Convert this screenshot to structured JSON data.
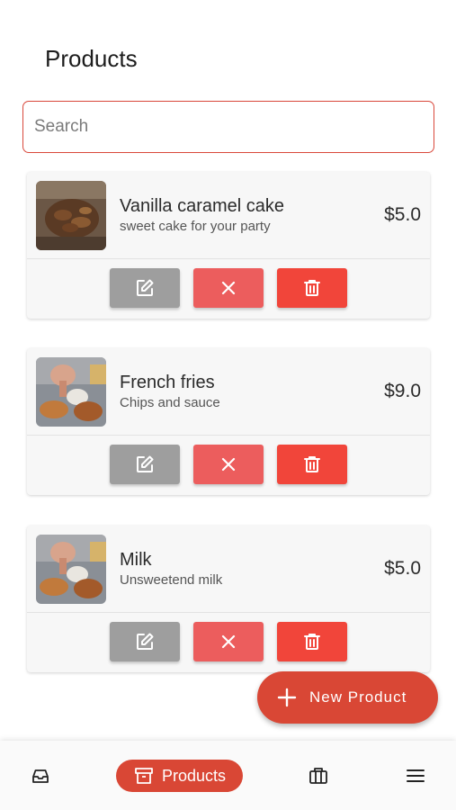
{
  "header": {
    "title": "Products"
  },
  "search": {
    "placeholder": "Search",
    "value": ""
  },
  "products": [
    {
      "name": "Vanilla caramel cake",
      "description": "sweet cake for your party",
      "price": "$5.0",
      "image": "cake-photo"
    },
    {
      "name": "French fries",
      "description": "Chips and sauce",
      "price": "$9.0",
      "image": "fries-photo"
    },
    {
      "name": "Milk",
      "description": "Unsweetend milk",
      "price": "$5.0",
      "image": "fries-photo"
    }
  ],
  "card_actions": {
    "edit_icon": "edit-icon",
    "cancel_icon": "close-icon",
    "delete_icon": "trash-icon"
  },
  "fab": {
    "label": "New Product",
    "icon": "plus-icon"
  },
  "bottom_nav": {
    "items": [
      {
        "icon": "inbox-icon"
      },
      {
        "label": "Products",
        "icon": "archive-icon",
        "active": true
      },
      {
        "icon": "briefcase-icon"
      },
      {
        "icon": "menu-icon"
      }
    ]
  },
  "colors": {
    "accent": "#d94735",
    "edit": "#9e9e9e",
    "cancel": "#ec5d5d",
    "delete": "#f1453a"
  }
}
